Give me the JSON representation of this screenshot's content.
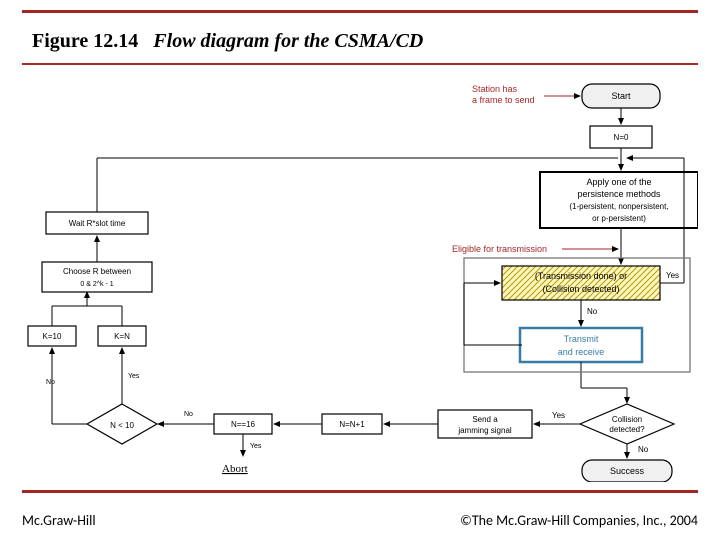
{
  "title_fig": "Figure 12.14",
  "title_cap": "Flow diagram for the CSMA/CD",
  "footer_left": "Mc.Graw-Hill",
  "footer_right": "©The Mc.Graw-Hill Companies, Inc., 2004",
  "nodes": {
    "station_has": "Station has a frame to send",
    "start": "Start",
    "n0": "N=0",
    "wait": "Wait R*slot time",
    "choose1": "Choose R between",
    "choose2": "0 & 2^k - 1",
    "k10": "K=10",
    "kn": "K=N",
    "nlt10": "N < 10",
    "n16": "N==16",
    "nn1": "N=N+1",
    "apply1": "Apply one of the",
    "apply2": "persistence methods",
    "apply3": "(1-persistent, nonpersistent,",
    "apply4": "or p-persistent)",
    "elig": "Eligible for transmission",
    "cond1": "(Transmission done) or",
    "cond2": "(Collision detected)",
    "tx1": "Transmit",
    "tx2": "and receive",
    "jam1": "Send a",
    "jam2": "jamming signal",
    "coll1": "Collision",
    "coll2": "detected?",
    "success": "Success",
    "abort": "Abort",
    "yes": "Yes",
    "no": "No"
  }
}
